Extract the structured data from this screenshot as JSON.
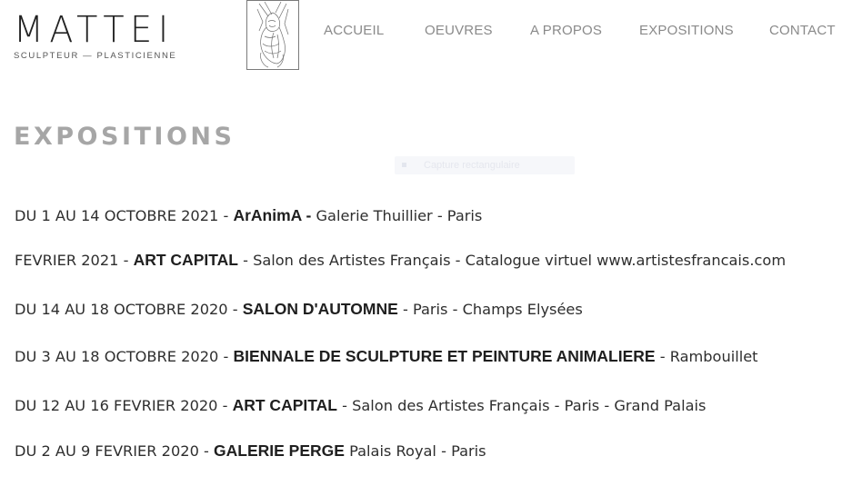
{
  "brand": {
    "name": "MATTEI",
    "tagline": "SCULPTEUR — PLASTICIENNE"
  },
  "nav": {
    "items": [
      {
        "label": "ACCUEIL"
      },
      {
        "label": "OEUVRES"
      },
      {
        "label": "A PROPOS"
      },
      {
        "label": "EXPOSITIONS"
      },
      {
        "label": "CONTACT"
      }
    ]
  },
  "page": {
    "title": "EXPOSITIONS"
  },
  "tooltip": {
    "label": "Capture rectangulaire"
  },
  "expositions": [
    {
      "date": "DU 1 AU 14 OCTOBRE 2021 - ",
      "name": "ArAnimA -",
      "details": " Galerie Thuillier - Paris"
    },
    {
      "date": "FEVRIER 2021 - ",
      "name": "ART CAPITAL",
      "details": " - Salon des Artistes Français - Catalogue virtuel www.artistesfrancais.com"
    },
    {
      "date": "DU 14 AU 18 OCTOBRE 2020 - ",
      "name": "SALON D'AUTOMNE",
      "details": " - Paris - Champs Elysées"
    },
    {
      "date": "DU 3 AU 18 OCTOBRE 2020 - ",
      "name": "BIENNALE DE SCULPTURE ET PEINTURE ANIMALIERE",
      "details": " - Rambouillet"
    },
    {
      "date": "DU 12 AU 16 FEVRIER 2020 - ",
      "name": "ART CAPITAL",
      "details": " - Salon des Artistes Français - Paris - Grand Palais"
    },
    {
      "date": "DU 2 AU 9 FEVRIER 2020 - ",
      "name": "GALERIE PERGE",
      "details": " Palais Royal - Paris"
    }
  ]
}
